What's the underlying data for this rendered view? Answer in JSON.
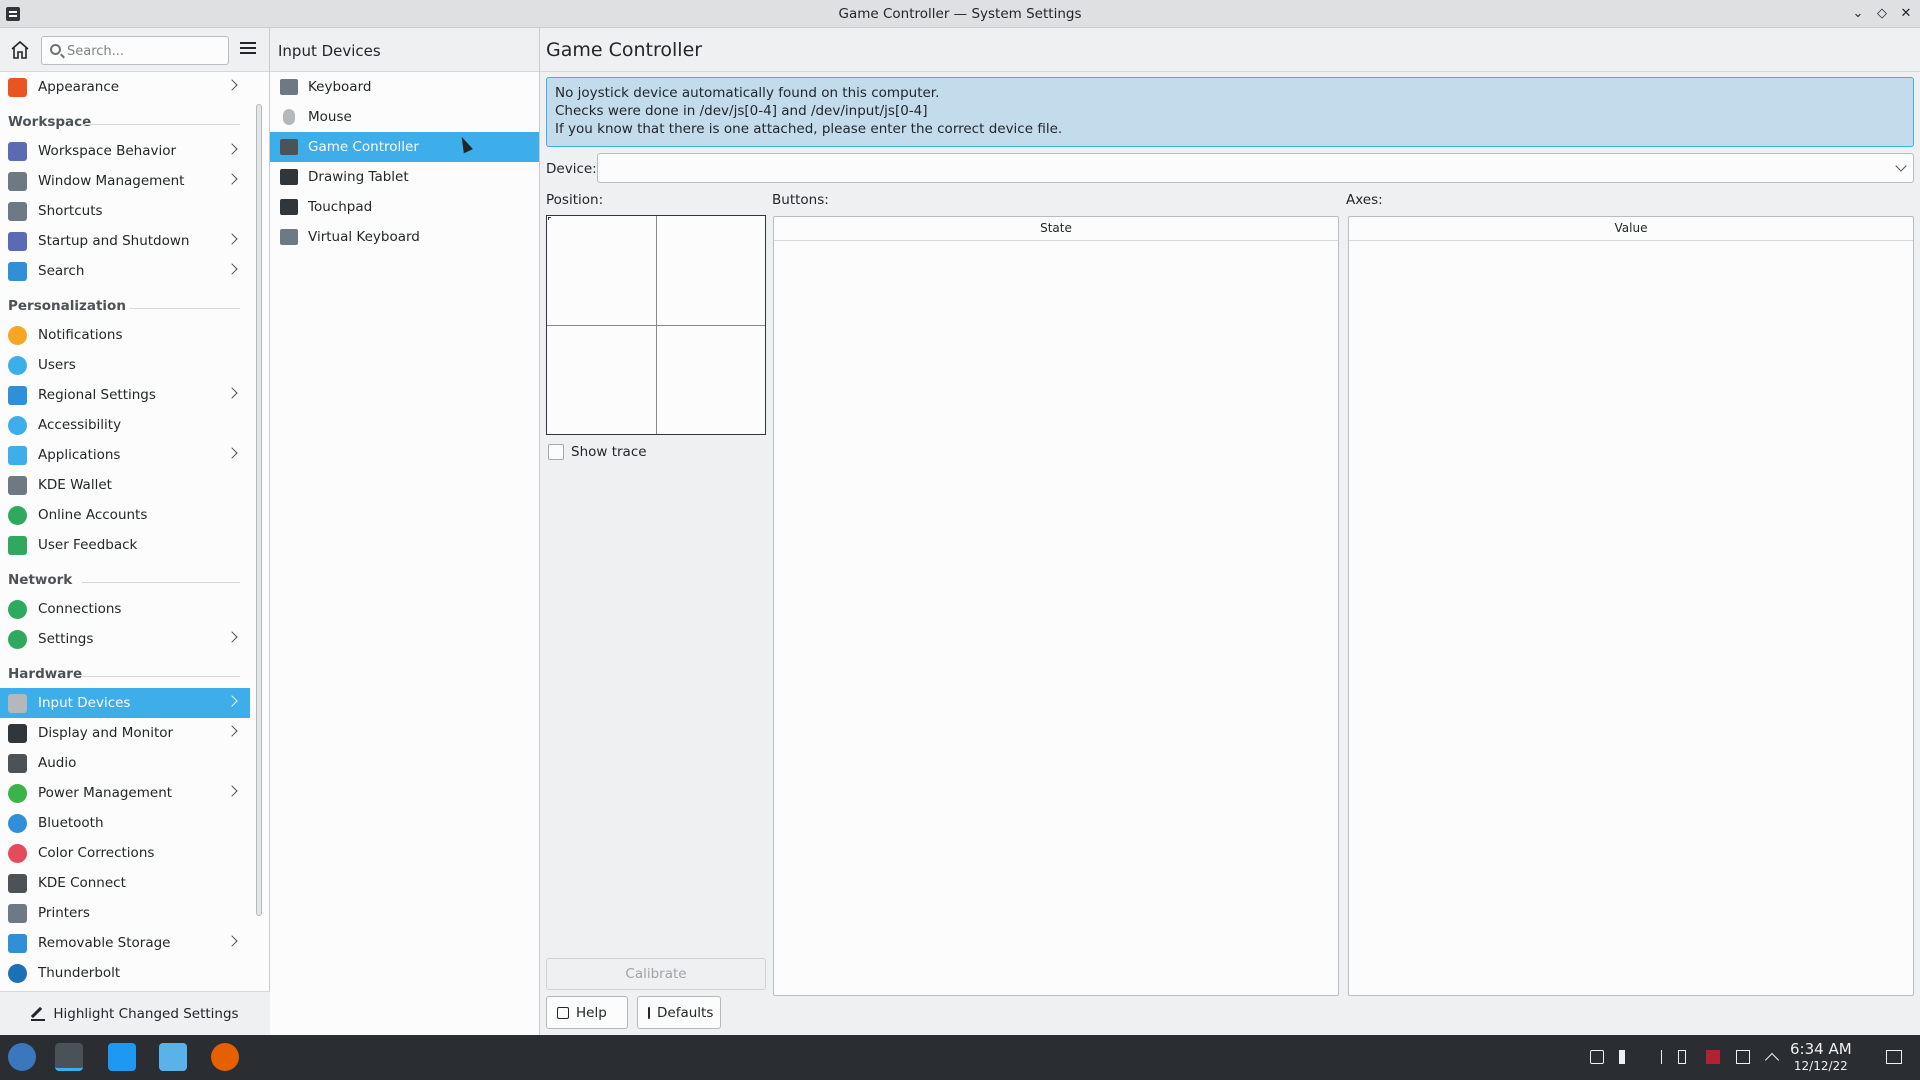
{
  "window": {
    "title": "Game Controller — System Settings"
  },
  "sidebar": {
    "search_placeholder": "Search...",
    "items": [
      {
        "label": "Appearance",
        "icon": "appearance-icon",
        "chevron": true
      },
      {
        "section": "Workspace"
      },
      {
        "label": "Workspace Behavior",
        "icon": "workspace-behavior-icon",
        "chevron": true
      },
      {
        "label": "Window Management",
        "icon": "window-management-icon",
        "chevron": true
      },
      {
        "label": "Shortcuts",
        "icon": "shortcuts-icon",
        "chevron": false
      },
      {
        "label": "Startup and Shutdown",
        "icon": "startup-icon",
        "chevron": true
      },
      {
        "label": "Search",
        "icon": "search-icon",
        "chevron": true
      },
      {
        "section": "Personalization"
      },
      {
        "label": "Notifications",
        "icon": "bell-icon",
        "chevron": false
      },
      {
        "label": "Users",
        "icon": "users-icon",
        "chevron": false
      },
      {
        "label": "Regional Settings",
        "icon": "regional-icon",
        "chevron": true
      },
      {
        "label": "Accessibility",
        "icon": "accessibility-icon",
        "chevron": false
      },
      {
        "label": "Applications",
        "icon": "applications-icon",
        "chevron": true
      },
      {
        "label": "KDE Wallet",
        "icon": "wallet-icon",
        "chevron": false
      },
      {
        "label": "Online Accounts",
        "icon": "online-accounts-icon",
        "chevron": false
      },
      {
        "label": "User Feedback",
        "icon": "feedback-icon",
        "chevron": false
      },
      {
        "section": "Network"
      },
      {
        "label": "Connections",
        "icon": "connections-icon",
        "chevron": false
      },
      {
        "label": "Settings",
        "icon": "network-settings-icon",
        "chevron": true
      },
      {
        "section": "Hardware"
      },
      {
        "label": "Input Devices",
        "icon": "mouse-icon",
        "chevron": true,
        "selected": true
      },
      {
        "label": "Display and Monitor",
        "icon": "monitor-icon",
        "chevron": true
      },
      {
        "label": "Audio",
        "icon": "audio-icon",
        "chevron": false
      },
      {
        "label": "Power Management",
        "icon": "power-icon",
        "chevron": true
      },
      {
        "label": "Bluetooth",
        "icon": "bluetooth-icon",
        "chevron": false
      },
      {
        "label": "Color Corrections",
        "icon": "color-icon",
        "chevron": false
      },
      {
        "label": "KDE Connect",
        "icon": "kde-connect-icon",
        "chevron": false
      },
      {
        "label": "Printers",
        "icon": "printer-icon",
        "chevron": false
      },
      {
        "label": "Removable Storage",
        "icon": "removable-storage-icon",
        "chevron": true
      },
      {
        "label": "Thunderbolt",
        "icon": "thunderbolt-icon",
        "chevron": false
      }
    ],
    "highlight_label": "Highlight Changed Settings"
  },
  "subpane": {
    "title": "Input Devices",
    "items": [
      {
        "label": "Keyboard",
        "icon": "keyboard-icon"
      },
      {
        "label": "Mouse",
        "icon": "mouse-icon"
      },
      {
        "label": "Game Controller",
        "icon": "gamepad-icon",
        "selected": true
      },
      {
        "label": "Drawing Tablet",
        "icon": "tablet-icon"
      },
      {
        "label": "Touchpad",
        "icon": "touchpad-icon"
      },
      {
        "label": "Virtual Keyboard",
        "icon": "virtual-keyboard-icon"
      }
    ]
  },
  "main": {
    "title": "Game Controller",
    "notice": [
      "No joystick device automatically found on this computer.",
      "Checks were done in /dev/js[0-4] and /dev/input/js[0-4]",
      "If you know that there is one attached, please enter the correct device file."
    ],
    "device_label": "Device:",
    "device_value": "",
    "position_label": "Position:",
    "buttons_label": "Buttons:",
    "axes_label": "Axes:",
    "buttons_col": "State",
    "axes_col": "Value",
    "show_trace": "Show trace",
    "calibrate": "Calibrate",
    "help": "Help",
    "defaults": "Defaults"
  },
  "taskbar": {
    "time": "6:34 AM",
    "date": "12/12/22"
  },
  "colors": {
    "accent": "#3daee9",
    "notice_bg": "#c3dcec",
    "taskbar": "#2a2e32"
  }
}
